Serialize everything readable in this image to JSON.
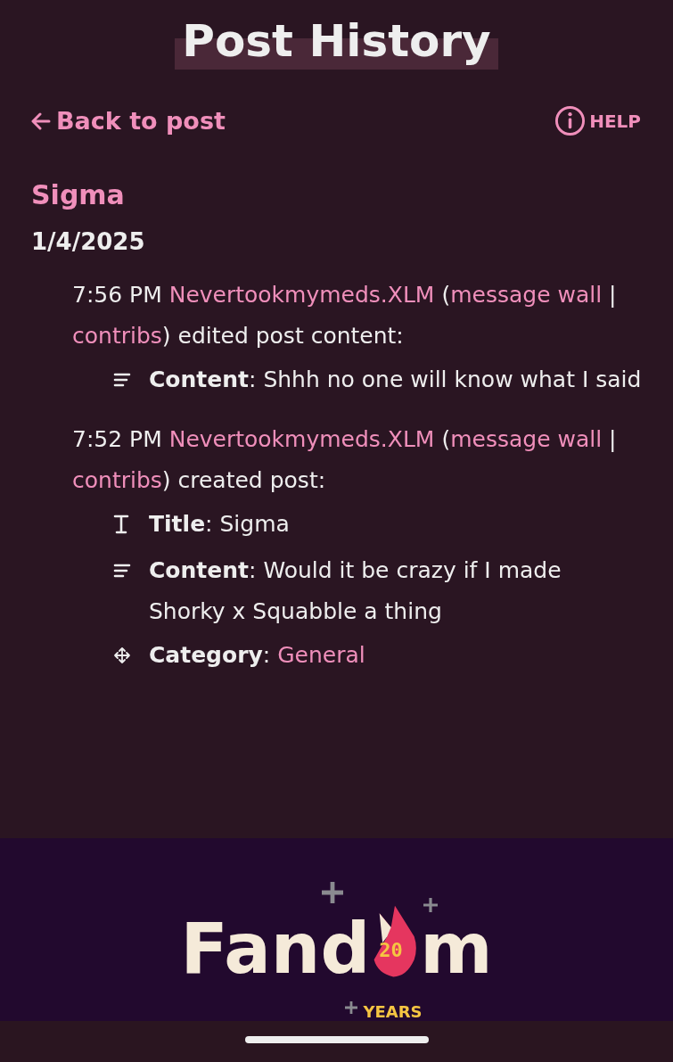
{
  "page": {
    "title": "Post History"
  },
  "nav": {
    "back": "Back to post",
    "help": "HELP"
  },
  "post": {
    "title": "Sigma",
    "date": "1/4/2025"
  },
  "entries": [
    {
      "time": "7:56 PM",
      "user": "Nevertookmymeds.XLM",
      "open": "(",
      "links": [
        "message wall",
        "contribs"
      ],
      "separator": "|",
      "close": ")",
      "action": "edited post content:",
      "changes": [
        {
          "kind": "content",
          "label": "**Content**:",
          "value": "Shhh no one will know what I said"
        }
      ]
    },
    {
      "time": "7:52 PM",
      "user": "Nevertookmymeds.XLM",
      "open": "(",
      "links": [
        "message wall",
        "contribs"
      ],
      "separator": "|",
      "close": ")",
      "action": "created post:",
      "changes": [
        {
          "kind": "title",
          "label": "**Title**:",
          "value": "Sigma"
        },
        {
          "kind": "content",
          "label": "**Content**:",
          "value": "Would it be crazy if I made Shorky x Squabble a thing"
        },
        {
          "kind": "category",
          "label": "**Category**:",
          "value": "General"
        }
      ]
    }
  ],
  "footer": {
    "logo_start": "Fand",
    "logo_badge": "20",
    "logo_end": "m",
    "logo_sub": "YEARS"
  }
}
